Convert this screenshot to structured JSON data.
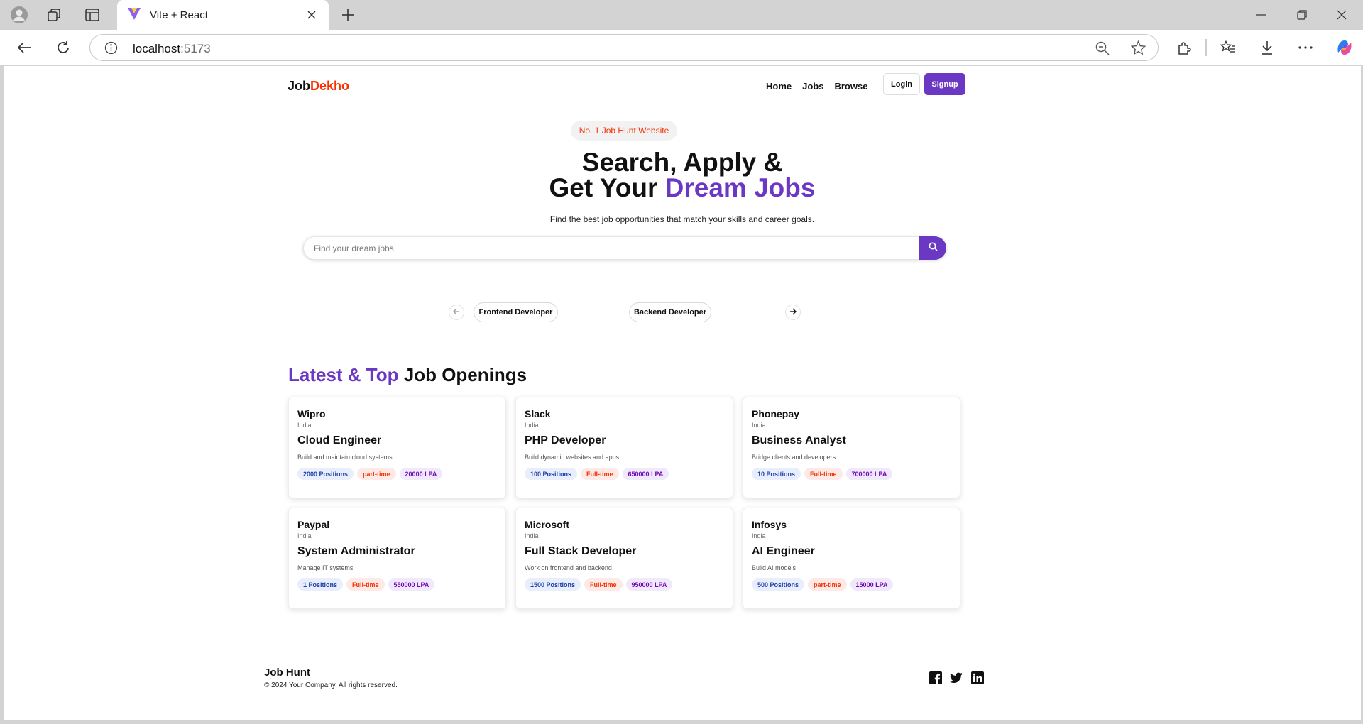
{
  "browser": {
    "tab_title": "Vite + React",
    "url_host": "localhost",
    "url_port": ":5173"
  },
  "nav": {
    "logo_main": "Job",
    "logo_accent": "Dekho",
    "links": [
      "Home",
      "Jobs",
      "Browse"
    ],
    "login": "Login",
    "signup": "Signup"
  },
  "hero": {
    "badge": "No. 1 Job Hunt Website",
    "title_line1": "Search, Apply &",
    "title_line2_prefix": "Get Your ",
    "title_line2_accent": "Dream Jobs",
    "subtitle": "Find the best job opportunities that match your skills and career goals.",
    "search_placeholder": "Find your dream jobs"
  },
  "categories": [
    "Frontend Developer",
    "Backend Developer"
  ],
  "section": {
    "title_accent": "Latest & Top",
    "title_rest": " Job Openings"
  },
  "jobs": [
    {
      "company": "Wipro",
      "location": "India",
      "title": "Cloud Engineer",
      "description": "Build and maintain cloud systems",
      "positions": "2000 Positions",
      "type": "part-time",
      "salary": "20000 LPA"
    },
    {
      "company": "Slack",
      "location": "India",
      "title": "PHP Developer",
      "description": "Build dynamic websites and apps",
      "positions": "100 Positions",
      "type": "Full-time",
      "salary": "650000 LPA"
    },
    {
      "company": "Phonepay",
      "location": "India",
      "title": "Business Analyst",
      "description": "Bridge clients and developers",
      "positions": "10 Positions",
      "type": "Full-time",
      "salary": "700000 LPA"
    },
    {
      "company": "Paypal",
      "location": "India",
      "title": "System Administrator",
      "description": "Manage IT systems",
      "positions": "1 Positions",
      "type": "Full-time",
      "salary": "550000 LPA"
    },
    {
      "company": "Microsoft",
      "location": "India",
      "title": "Full Stack Developer",
      "description": "Work on frontend and backend",
      "positions": "1500 Positions",
      "type": "Full-time",
      "salary": "950000 LPA"
    },
    {
      "company": "Infosys",
      "location": "India",
      "title": "AI Engineer",
      "description": "Build AI models",
      "positions": "500 Positions",
      "type": "part-time",
      "salary": "15000 LPA"
    }
  ],
  "footer": {
    "title": "Job Hunt",
    "copyright": "© 2024 Your Company. All rights reserved.",
    "social_icons": [
      "facebook-icon",
      "twitter-icon",
      "linkedin-icon"
    ]
  },
  "colors": {
    "brand_purple": "#6a38c2",
    "brand_red": "#f83002"
  }
}
